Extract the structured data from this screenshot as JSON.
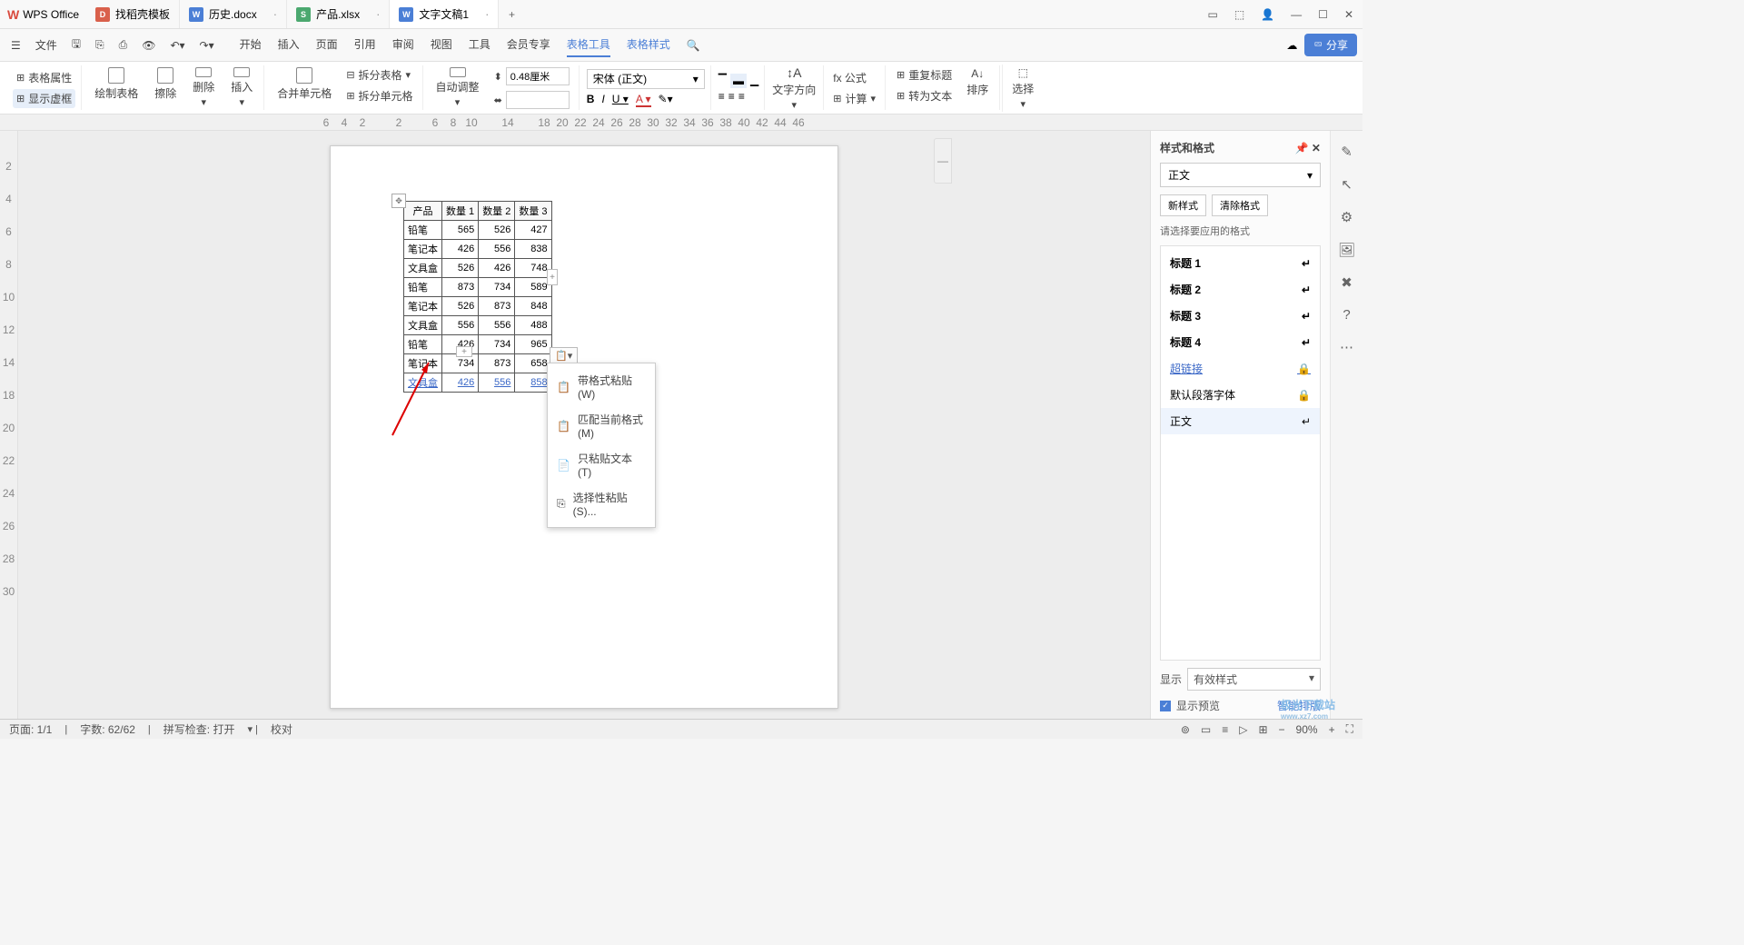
{
  "app": {
    "name": "WPS Office"
  },
  "tabs": [
    {
      "icon": "d",
      "label": "找稻壳模板",
      "close": ""
    },
    {
      "icon": "w",
      "label": "历史.docx",
      "close": "·"
    },
    {
      "icon": "s",
      "label": "产品.xlsx",
      "close": "·"
    },
    {
      "icon": "w",
      "label": "文字文稿1",
      "close": "·",
      "active": true
    }
  ],
  "menubar": {
    "file": "文件",
    "tabs": [
      "开始",
      "插入",
      "页面",
      "引用",
      "审阅",
      "视图",
      "工具",
      "会员专享",
      "表格工具",
      "表格样式"
    ],
    "active": "表格工具"
  },
  "ribbon": {
    "g1": {
      "a": "表格属性",
      "b": "显示虚框"
    },
    "g2": {
      "a": "绘制表格",
      "b": "擦除",
      "c": "删除",
      "d": "插入"
    },
    "g3": {
      "a": "合并单元格",
      "b": "拆分表格",
      "c": "拆分单元格"
    },
    "g4": {
      "a": "自动调整",
      "h": "0.48厘米",
      "w": ""
    },
    "font": "宋体 (正文)",
    "g6": {
      "a": "文字方向"
    },
    "g7": {
      "a": "fx 公式",
      "b": "计算",
      "c": "重复标题",
      "d": "转为文本",
      "e": "排序"
    },
    "g8": {
      "a": "选择"
    }
  },
  "ruler": [
    "6",
    "4",
    "2",
    "",
    "2",
    "",
    "6",
    "8",
    "10",
    "",
    "14",
    "",
    "18",
    "20",
    "22",
    "24",
    "26",
    "28",
    "30",
    "32",
    "34",
    "36",
    "38",
    "40",
    "42",
    "44",
    "46"
  ],
  "vruler": [
    "",
    "2",
    "4",
    "6",
    "8",
    "10",
    "12",
    "14",
    "18",
    "20",
    "22",
    "24",
    "26",
    "28",
    "30"
  ],
  "table": {
    "header": [
      "产品",
      "数量 1",
      "数量 2",
      "数量 3"
    ],
    "rows": [
      [
        "铅笔",
        "565",
        "526",
        "427"
      ],
      [
        "笔记本",
        "426",
        "556",
        "838"
      ],
      [
        "文具盒",
        "526",
        "426",
        "748"
      ],
      [
        "铅笔",
        "873",
        "734",
        "589"
      ],
      [
        "笔记本",
        "526",
        "873",
        "848"
      ],
      [
        "文具盒",
        "556",
        "556",
        "488"
      ],
      [
        "铅笔",
        "426",
        "734",
        "965"
      ],
      [
        "笔记本",
        "734",
        "873",
        "658"
      ],
      [
        "文具盒",
        "426",
        "556",
        "858"
      ]
    ]
  },
  "context": [
    {
      "icon": "📋",
      "label": "带格式粘贴(W)"
    },
    {
      "icon": "📋",
      "label": "匹配当前格式(M)"
    },
    {
      "icon": "📄",
      "label": "只粘贴文本(T)"
    },
    {
      "icon": "⎘",
      "label": "选择性粘贴(S)..."
    }
  ],
  "styles": {
    "title": "样式和格式",
    "current": "正文",
    "btn1": "新样式",
    "btn2": "清除格式",
    "hint": "请选择要应用的格式",
    "items": [
      {
        "label": "标题 1",
        "cls": "h1"
      },
      {
        "label": "标题 2",
        "cls": "h2"
      },
      {
        "label": "标题 3",
        "cls": "h3"
      },
      {
        "label": "标题 4",
        "cls": "h4"
      },
      {
        "label": "超链接",
        "cls": "link",
        "lock": true
      },
      {
        "label": "默认段落字体",
        "cls": "",
        "lock": true
      },
      {
        "label": "正文",
        "cls": "sel"
      }
    ],
    "show": "显示",
    "filter": "有效样式",
    "preview": "显示预览",
    "smart": "智能排版"
  },
  "status": {
    "page": "页面: 1/1",
    "words": "字数: 62/62",
    "spell": "拼写检查: 打开",
    "review": "校对",
    "zoom": "90%"
  },
  "share": "分享",
  "watermark": {
    "a": "极光下载站",
    "b": "www.xz7.com"
  }
}
